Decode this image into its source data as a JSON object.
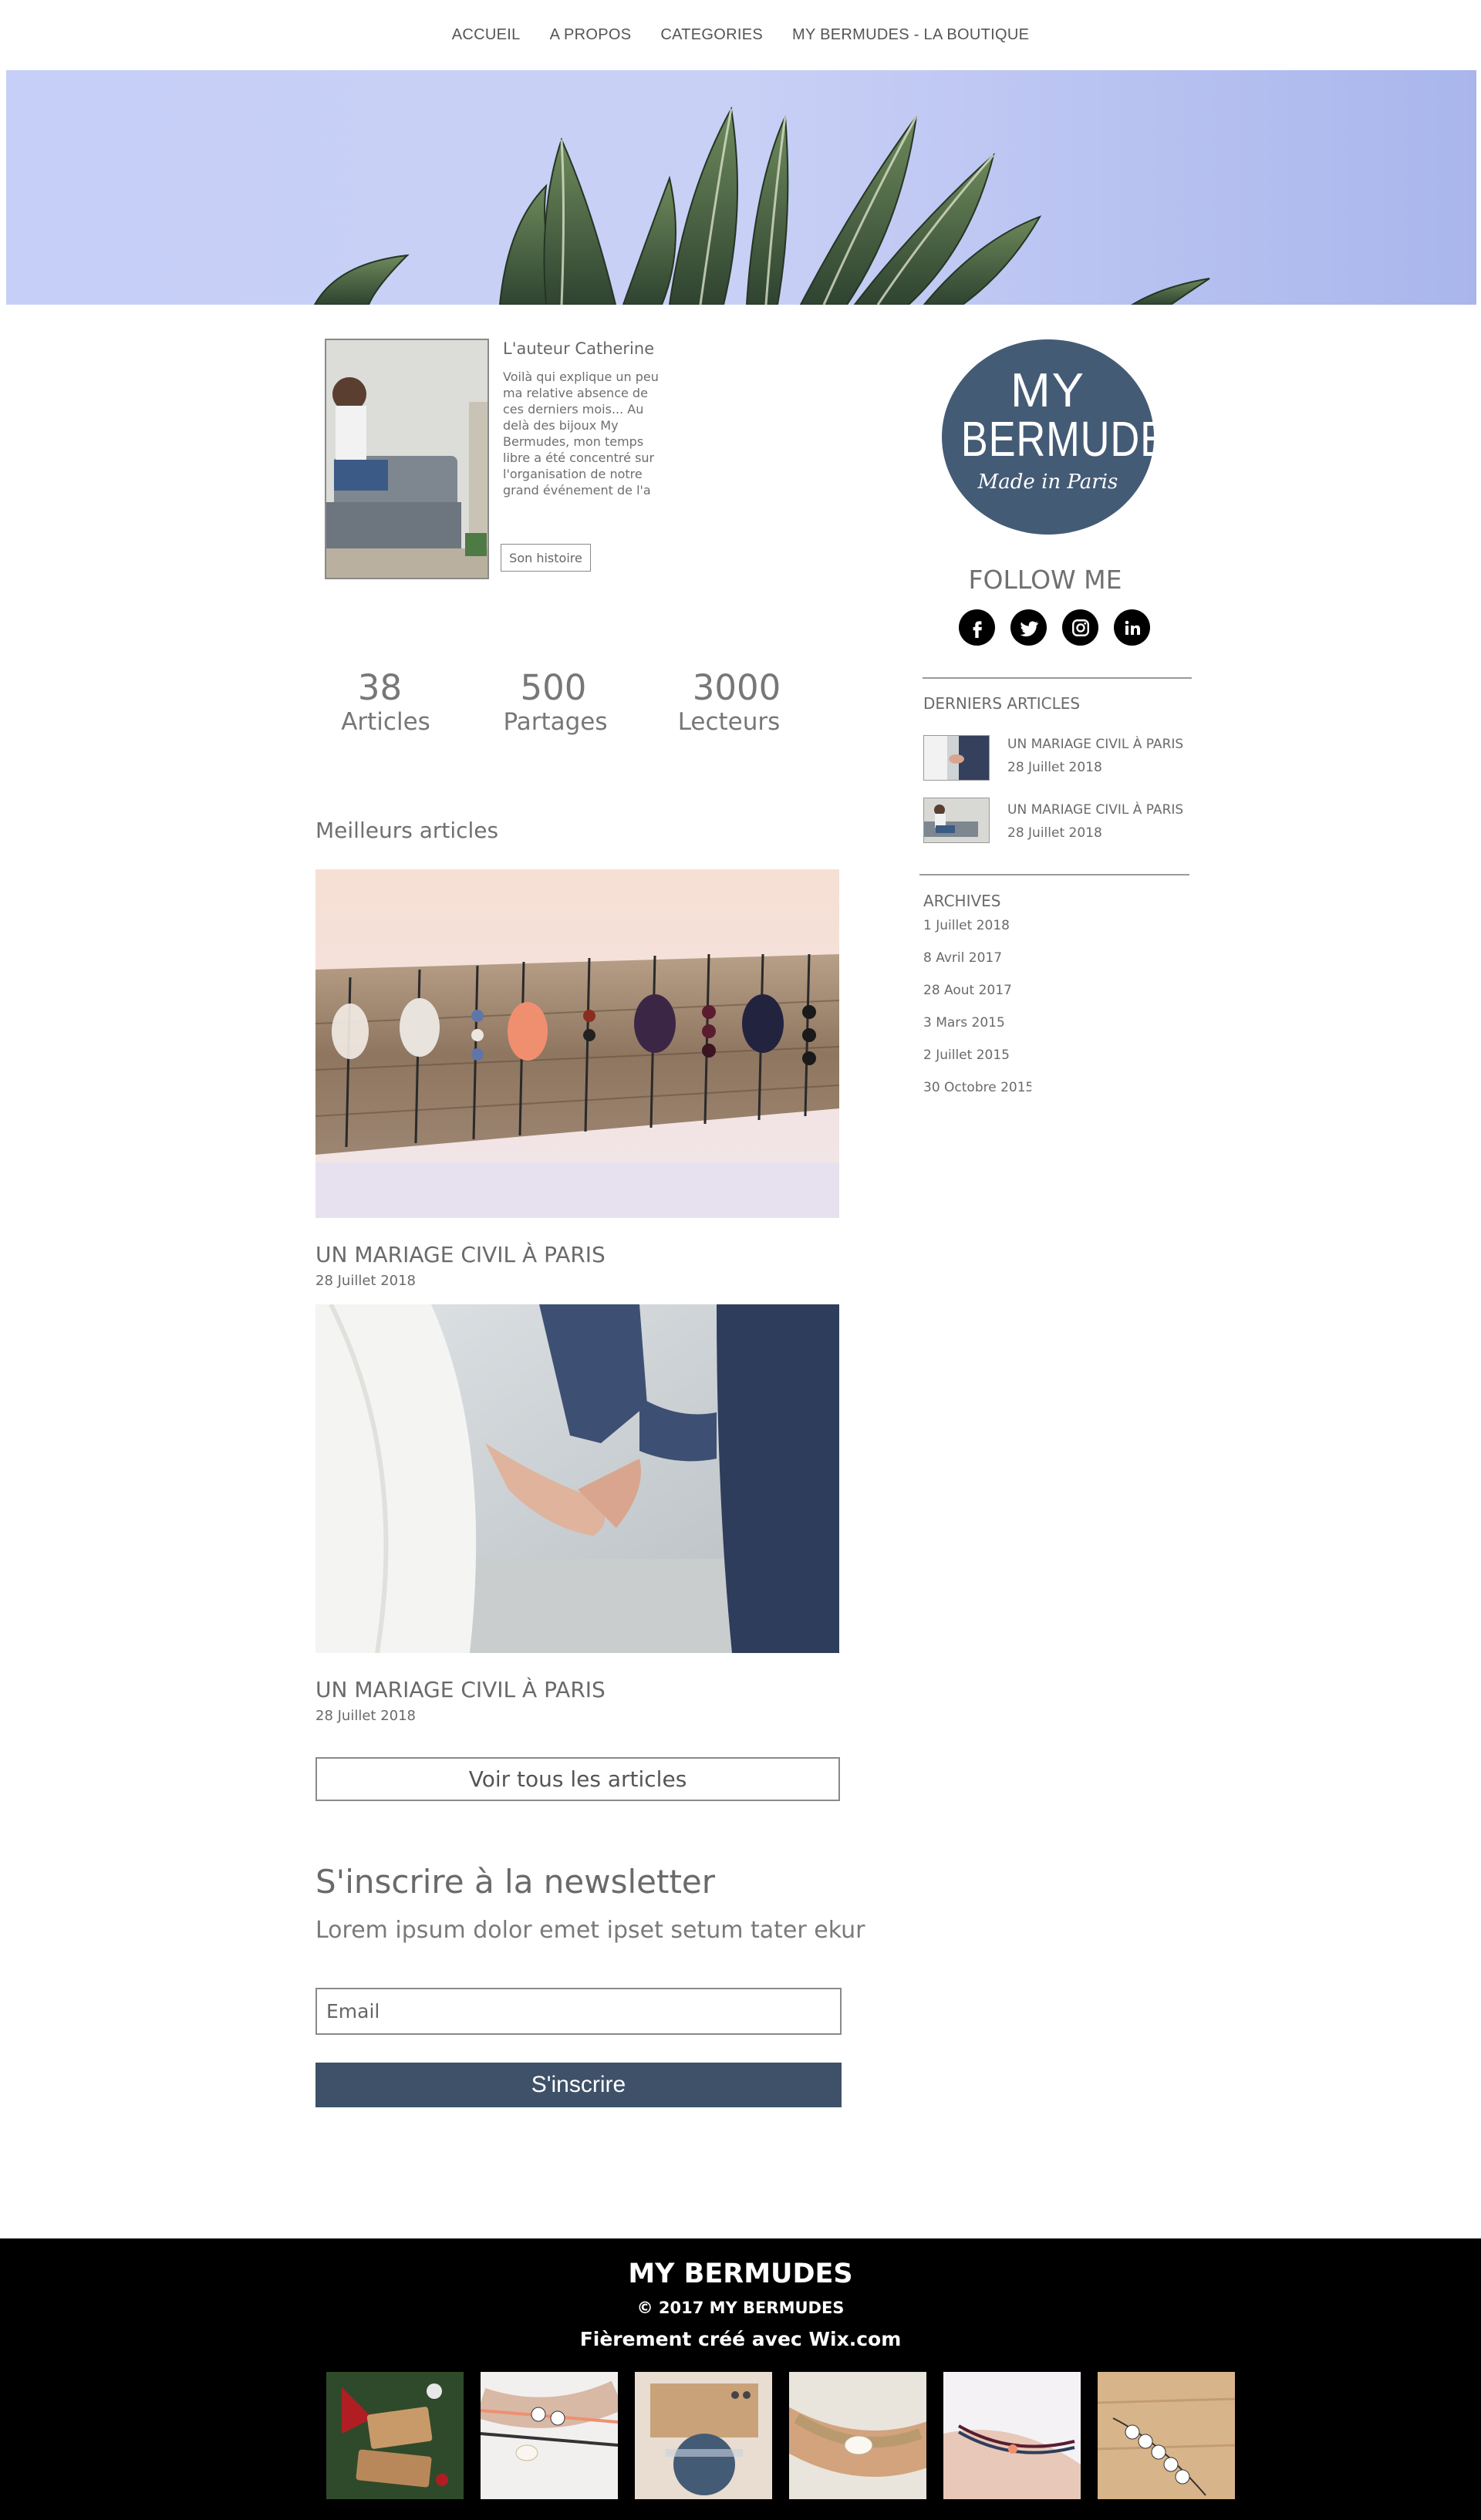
{
  "nav": {
    "items": [
      "ACCUEIL",
      "A PROPOS",
      "CATEGORIES",
      "MY BERMUDES - LA BOUTIQUE"
    ]
  },
  "author": {
    "title": "L'auteur Catherine",
    "text": "Voilà qui explique un peu ma relative absence de ces derniers mois... Au delà des bijoux My Bermudes, mon temps libre a été concentré sur l'organisation de notre grand événement de l'a",
    "button": "Son histoire"
  },
  "stats": [
    {
      "value": "38",
      "label": "Articles"
    },
    {
      "value": "500",
      "label": "Partages"
    },
    {
      "value": "3000",
      "label": "Lecteurs"
    }
  ],
  "best_articles": {
    "heading": "Meilleurs articles",
    "posts": [
      {
        "title": "UN MARIAGE CIVIL À PARIS",
        "date": "28 Juillet  2018",
        "image": "bracelets-photo"
      },
      {
        "title": "UN MARIAGE CIVIL À PARIS",
        "date": "28 Juillet  2018",
        "image": "holding-hands-photo"
      }
    ],
    "all_button": "Voir tous les articles"
  },
  "newsletter": {
    "title": "S'inscrire à la newsletter",
    "subtitle": "Lorem ipsum dolor emet ipset setum tater ekur",
    "email_placeholder": "Email",
    "button": "S'inscrire"
  },
  "sidebar": {
    "logo": {
      "line1": "MY",
      "line2": "BERMUDES",
      "line3": "Made in Paris"
    },
    "follow": "FOLLOW ME",
    "social": [
      "facebook-icon",
      "twitter-icon",
      "instagram-icon",
      "linkedin-icon"
    ],
    "recent_heading": "DERNIERS ARTICLES",
    "recent": [
      {
        "title": "UN MARIAGE CIVIL À PARIS",
        "date": "28 Juillet  2018"
      },
      {
        "title": "UN MARIAGE CIVIL À PARIS",
        "date": "28 Juillet  2018"
      }
    ],
    "archives_heading": "ARCHIVES",
    "archives": [
      "1 Juillet  2018",
      "8 Avril  2017",
      "28 Aout  2017",
      "3 Mars  2015",
      "2 Juillet  2015",
      "30 Octobre  2015"
    ]
  },
  "footer": {
    "brand": "MY BERMUDES",
    "copyright": "© 2017 MY BERMUDES",
    "made_with": "Fièrement créé avec Wix.com"
  },
  "colors": {
    "accent": "#3e5168",
    "logo_bg": "#445b76",
    "hero_sky": "#c6cff7",
    "footer_bg": "#000000"
  }
}
